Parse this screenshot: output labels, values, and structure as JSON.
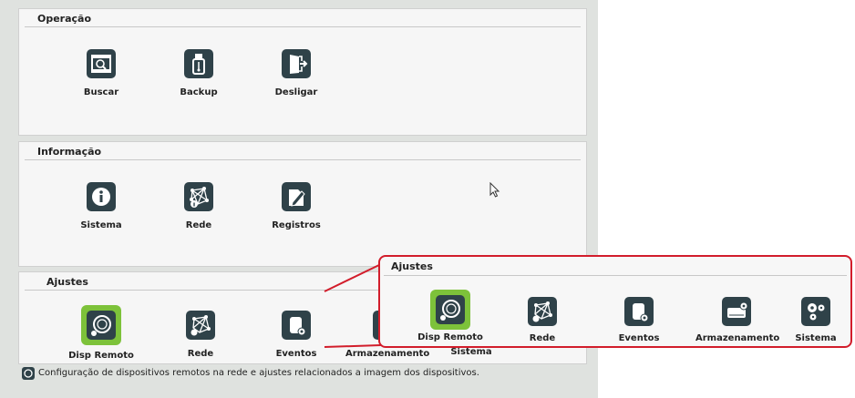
{
  "sections": {
    "operacao": {
      "title": "Operação",
      "items": [
        {
          "label": "Buscar",
          "icon": "film-search-icon"
        },
        {
          "label": "Backup",
          "icon": "usb-drive-icon"
        },
        {
          "label": "Desligar",
          "icon": "exit-door-icon"
        }
      ]
    },
    "informacao": {
      "title": "Informação",
      "items": [
        {
          "label": "Sistema",
          "icon": "info-icon"
        },
        {
          "label": "Rede",
          "icon": "network-icon"
        },
        {
          "label": "Registros",
          "icon": "document-pen-icon"
        }
      ]
    },
    "ajustes": {
      "title": "Ajustes",
      "items": [
        {
          "label": "Disp Remoto",
          "icon": "remote-camera-icon",
          "selected": true
        },
        {
          "label": "Rede",
          "icon": "network-settings-icon"
        },
        {
          "label": "Eventos",
          "icon": "events-settings-icon"
        },
        {
          "label": "Armazenamento",
          "icon": "storage-settings-icon"
        },
        {
          "label": "Sistema",
          "icon": "system-gears-icon"
        }
      ]
    }
  },
  "status_text": "Configuração de dispositivos remotos na rede e ajustes relacionados a imagem dos dispositivos.",
  "colors": {
    "icon_bg": "#2f4249",
    "selected_bg": "#7dc23a",
    "highlight": "#d21d2b"
  }
}
